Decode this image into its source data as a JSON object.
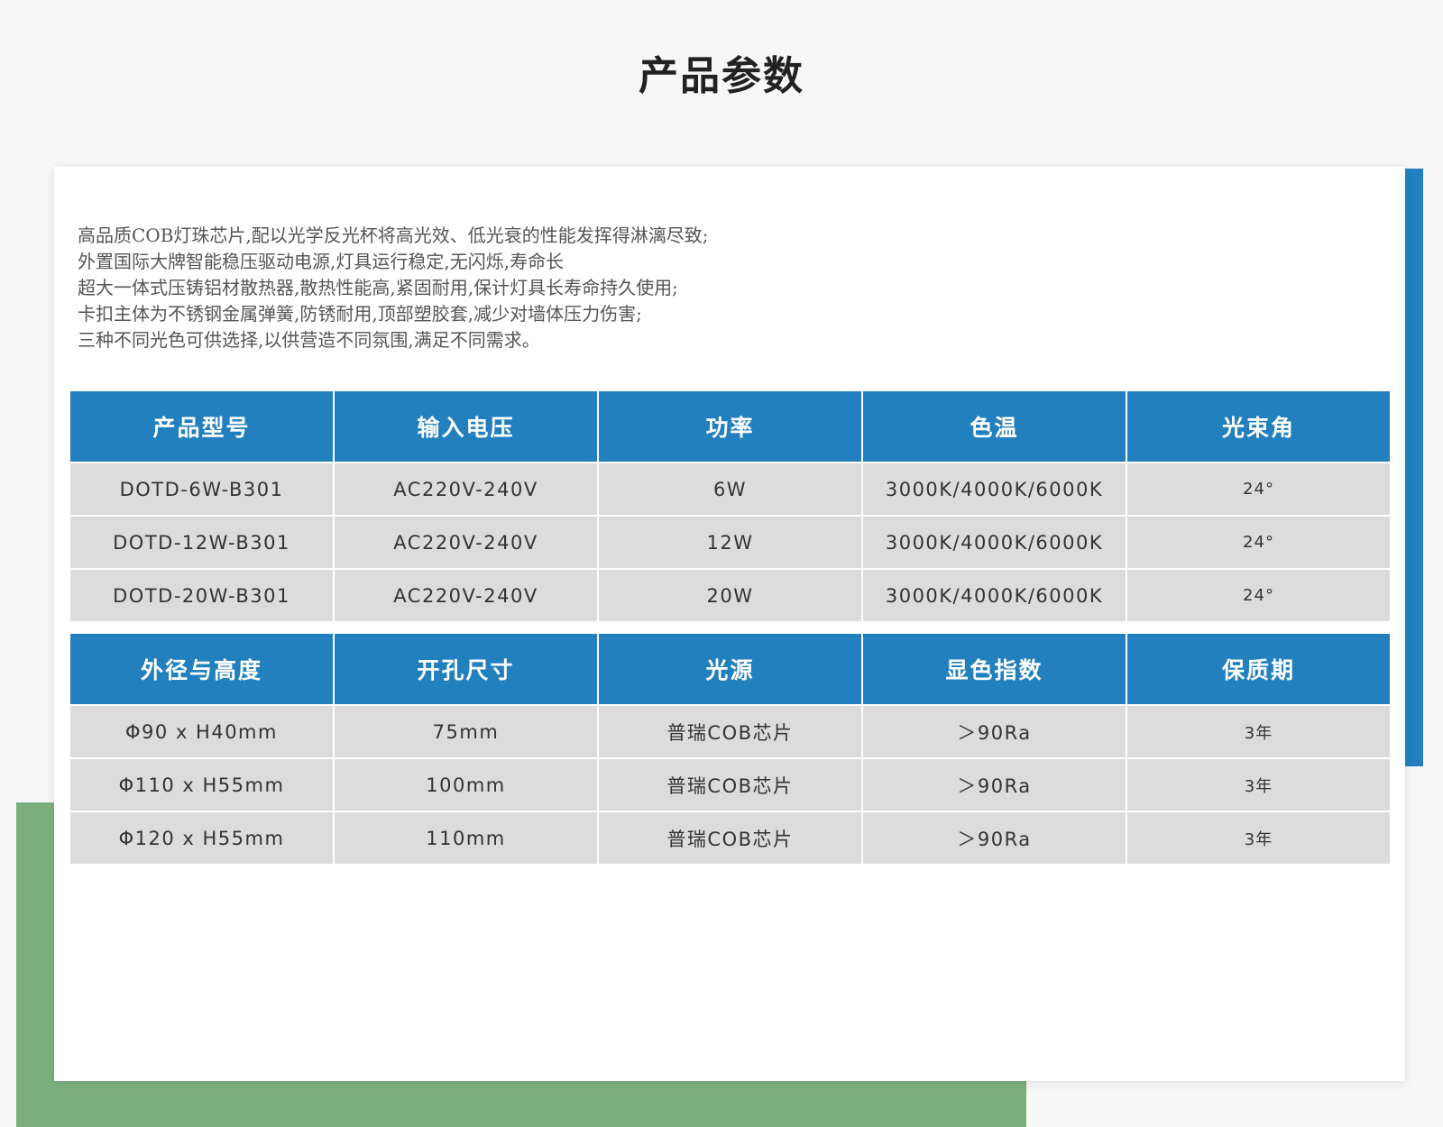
{
  "page_title": "产品参数",
  "features": [
    "高品质COB灯珠芯片,配以光学反光杯将高光效、低光衰的性能发挥得淋漓尽致;",
    "外置国际大牌智能稳压驱动电源,灯具运行稳定,无闪烁,寿命长",
    "超大一体式压铸铝材散热器,散热性能高,紧固耐用,保计灯具长寿命持久使用;",
    "卡扣主体为不锈钢金属弹簧,防锈耐用,顶部塑胶套,减少对墙体压力伤害;",
    "三种不同光色可供选择,以供营造不同氛围,满足不同需求。"
  ],
  "table1": {
    "headers": [
      "产品型号",
      "输入电压",
      "功率",
      "色温",
      "光束角"
    ],
    "rows": [
      [
        "DOTD-6W-B301",
        "AC220V-240V",
        "6W",
        "3000K/4000K/6000K",
        "24°"
      ],
      [
        "DOTD-12W-B301",
        "AC220V-240V",
        "12W",
        "3000K/4000K/6000K",
        "24°"
      ],
      [
        "DOTD-20W-B301",
        "AC220V-240V",
        "20W",
        "3000K/4000K/6000K",
        "24°"
      ]
    ]
  },
  "table2": {
    "headers": [
      "外径与高度",
      "开孔尺寸",
      "光源",
      "显色指数",
      "保质期"
    ],
    "rows": [
      [
        "Φ90 x H40mm",
        "75mm",
        "普瑞COB芯片",
        "＞90Ra",
        "3年"
      ],
      [
        "Φ110 x H55mm",
        "100mm",
        "普瑞COB芯片",
        "＞90Ra",
        "3年"
      ],
      [
        "Φ120 x H55mm",
        "110mm",
        "普瑞COB芯片",
        "＞90Ra",
        "3年"
      ]
    ]
  },
  "colors": {
    "header_blue": "#2380be",
    "accent_green": "#7caf7e",
    "row_gray": "#dcdcdc"
  }
}
